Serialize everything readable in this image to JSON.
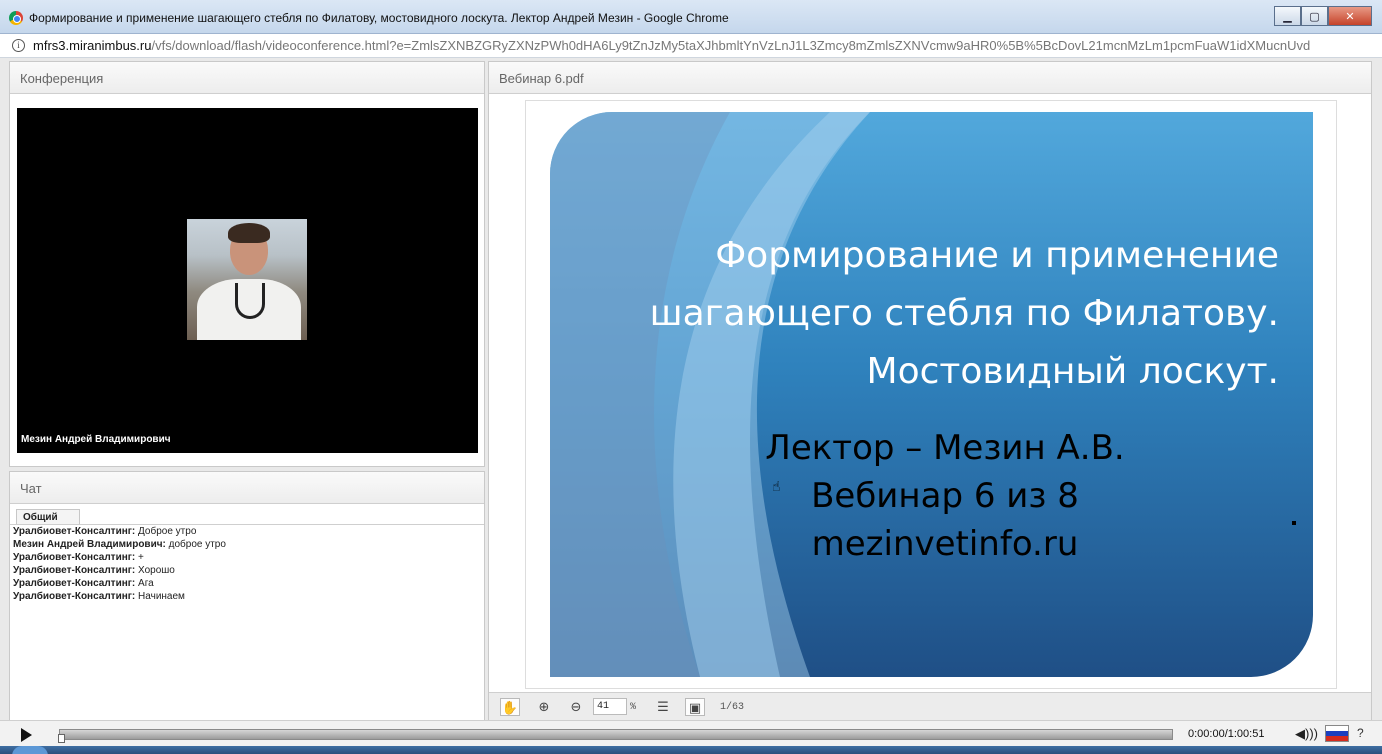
{
  "window": {
    "title": "Формирование и применение шагающего стебля по Филатову, мостовидного лоскута. Лектор Андрей Мезин - Google Chrome",
    "buttons": {
      "minimize": "▁",
      "maximize": "▢",
      "close": "✕"
    }
  },
  "address": {
    "host": "mfrs3.miranimbus.ru",
    "path": "/vfs/download/flash/videoconference.html?e=ZmlsZXNBZGRyZXNzPWh0dHA6Ly9tZnJzMy5taXJhbmltYnVzLnJ1L3Zmcy8mZmlsZXNVcmw9aHR0%5B%5BcDovL21mcnMzLm1pcmFuaW1idXMucnUvd"
  },
  "conference": {
    "header": "Конференция",
    "participant_name": "Мезин Андрей Владимирович"
  },
  "chat": {
    "header": "Чат",
    "tab": "Общий",
    "messages": [
      {
        "author": "Уралбиовет-Консалтинг:",
        "text": "Доброе утро"
      },
      {
        "author": "Мезин Андрей Владимирович:",
        "text": "доброе утро"
      },
      {
        "author": "Уралбиовет-Консалтинг:",
        "text": "+"
      },
      {
        "author": "Уралбиовет-Консалтинг:",
        "text": "Хорошо"
      },
      {
        "author": "Уралбиовет-Консалтинг:",
        "text": "Ага"
      },
      {
        "author": "Уралбиовет-Консалтинг:",
        "text": "Начинаем"
      }
    ]
  },
  "viewer": {
    "header": "Вебинар 6.pdf",
    "slide": {
      "title_lines": [
        "Формирование и применение",
        "шагающего стебля по Филатову.",
        "Мостовидный лоскут."
      ],
      "info_lines": [
        "Лектор – Мезин А.В.",
        "Вебинар 6 из 8",
        "mezinvetinfo.ru"
      ]
    },
    "toolbar": {
      "zoom_value": "41",
      "zoom_unit": "%",
      "page_indicator": "1/63",
      "icons": [
        "hand-icon",
        "zoom-in-icon",
        "zoom-out-icon",
        "fit-width-icon",
        "fit-page-icon"
      ]
    }
  },
  "player": {
    "time": "0:00:00/1:00:51",
    "progress": 0,
    "help": "?"
  }
}
